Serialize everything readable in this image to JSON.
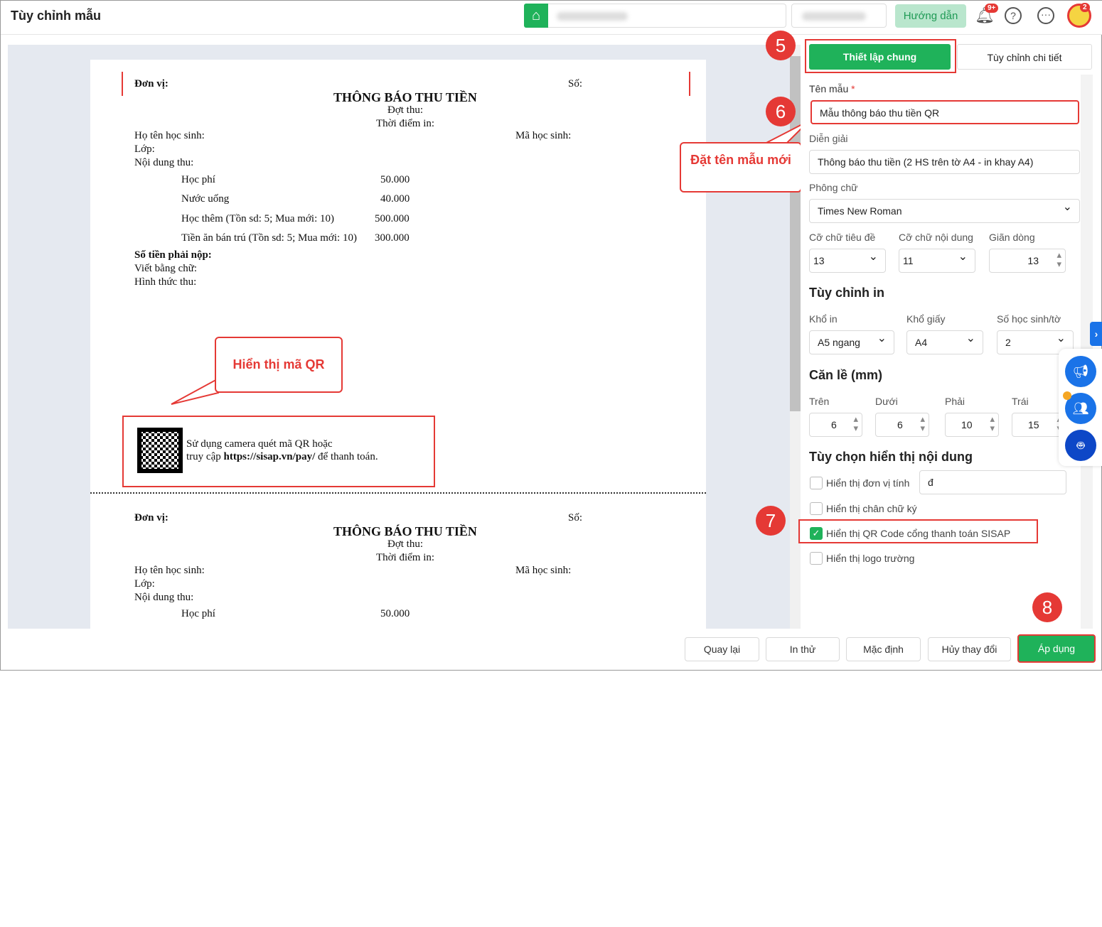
{
  "header": {
    "title": "Tùy chỉnh mẫu",
    "guide": "Hướng dẫn",
    "notif_badge": "9+",
    "avatar_badge": "2"
  },
  "receipt": {
    "unit": "Đơn vị:",
    "number": "Số:",
    "title": "THÔNG BÁO THU TIỀN",
    "batch": "Đợt thu:",
    "print_time": "Thời điểm in:",
    "student_name": "Họ tên học sinh:",
    "student_code": "Mã học sinh:",
    "class": "Lớp:",
    "content": "Nội dung thu:",
    "items": [
      {
        "name": "Học phí",
        "amount": "50.000"
      },
      {
        "name": "Nước uống",
        "amount": "40.000"
      },
      {
        "name": "Học thêm (Tồn sd: 5; Mua mới: 10)",
        "amount": "500.000"
      },
      {
        "name": "Tiền ăn bán trú (Tồn sd: 5; Mua mới: 10)",
        "amount": "300.000"
      }
    ],
    "total": "Số tiền phải nộp:",
    "in_words": "Viết bằng chữ:",
    "method": "Hình thức thu:",
    "qr_line1": "Sử dụng camera quét mã QR hoặc",
    "qr_line2_pre": "truy cập ",
    "qr_url": "https://sisap.vn/pay/",
    "qr_line2_post": " để thanh toán."
  },
  "annotations": {
    "qr_callout": "Hiển thị mã QR",
    "name_callout": "Đặt tên mẫu mới",
    "n5": "5",
    "n6": "6",
    "n7": "7",
    "n8": "8"
  },
  "panel": {
    "tab_general": "Thiết lập chung",
    "tab_detail": "Tùy chỉnh chi tiết",
    "name_label": "Tên mẫu",
    "required": "*",
    "name_value": "Mẫu thông báo thu tiền QR",
    "desc_label": "Diễn giải",
    "desc_value": "Thông báo thu tiền (2 HS trên tờ A4 - in khay A4)",
    "font_label": "Phông chữ",
    "font_value": "Times New Roman",
    "title_size_label": "Cỡ chữ tiêu đề",
    "title_size": "13",
    "body_size_label": "Cỡ chữ nội dung",
    "body_size": "11",
    "spacing_label": "Giãn dòng",
    "spacing": "13",
    "print_heading": "Tùy chỉnh in",
    "print_size_label": "Khổ in",
    "print_size": "A5 ngang",
    "paper_label": "Khổ giấy",
    "paper": "A4",
    "per_sheet_label": "Số học sinh/tờ",
    "per_sheet": "2",
    "margin_heading": "Căn lề (mm)",
    "top_label": "Trên",
    "top": "6",
    "bottom_label": "Dưới",
    "bottom": "6",
    "right_label": "Phải",
    "right": "10",
    "left_label": "Trái",
    "left": "15",
    "display_heading": "Tùy chọn hiển thị nội dung",
    "opt_unit": "Hiển thị đơn vị tính",
    "unit_value": "đ",
    "opt_signature": "Hiển thị chân chữ ký",
    "opt_qr": "Hiển thị QR Code cổng thanh toán SISAP",
    "opt_logo": "Hiển thị logo trường"
  },
  "footer": {
    "back": "Quay lại",
    "test_print": "In thử",
    "default": "Mặc định",
    "cancel": "Hủy thay đổi",
    "apply": "Áp dụng"
  }
}
